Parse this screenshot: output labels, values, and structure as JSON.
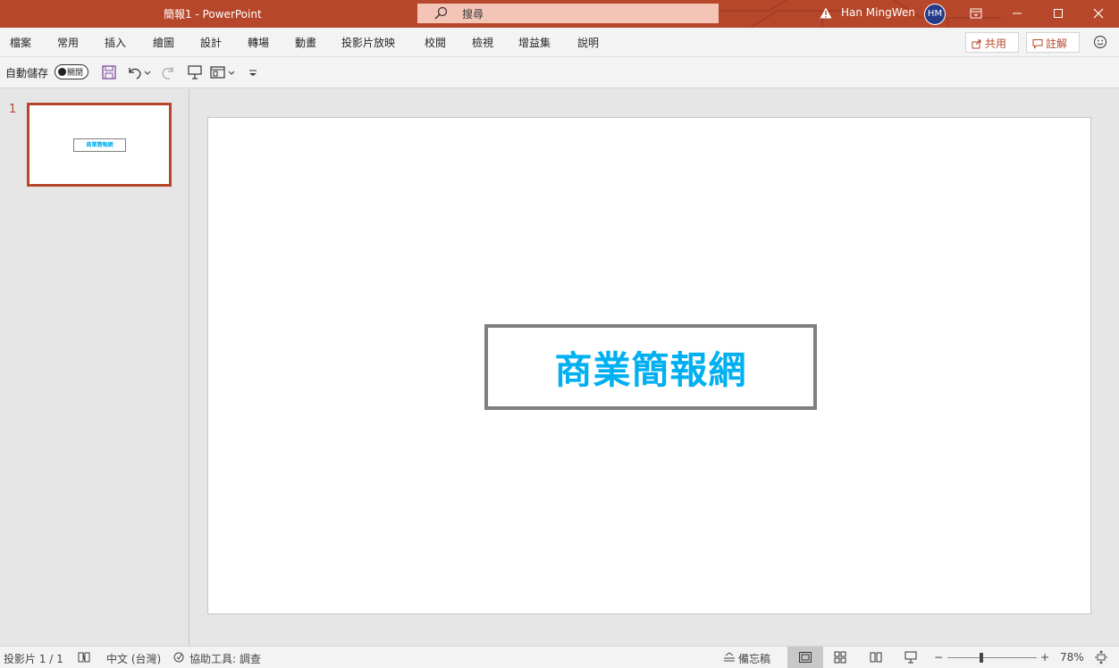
{
  "window": {
    "title": "簡報1  -  PowerPoint",
    "search_placeholder": "搜尋",
    "user_name": "Han MingWen",
    "user_initials": "HM"
  },
  "ribbon": {
    "tabs": [
      "檔案",
      "常用",
      "插入",
      "繪圖",
      "設計",
      "轉場",
      "動畫",
      "投影片放映",
      "校閱",
      "檢視",
      "增益集",
      "說明"
    ],
    "share_label": "共用",
    "comments_label": "註解"
  },
  "qat": {
    "autosave_label": "自動儲存",
    "autosave_state": "關閉"
  },
  "thumbnails": [
    {
      "number": "1",
      "text": "商業簡報網"
    }
  ],
  "slide": {
    "title_text": "商業簡報網",
    "title_color": "#00b0f0",
    "box_border_color": "#7f7f7f"
  },
  "statusbar": {
    "slide_counter": "投影片 1 / 1",
    "language": "中文 (台灣)",
    "accessibility": "協助工具: 調查",
    "notes_label": "備忘稿",
    "zoom_minus": "−",
    "zoom_plus": "+",
    "zoom_percent": "78%"
  },
  "colors": {
    "accent": "#b7472a",
    "avatar": "#253b8a"
  }
}
